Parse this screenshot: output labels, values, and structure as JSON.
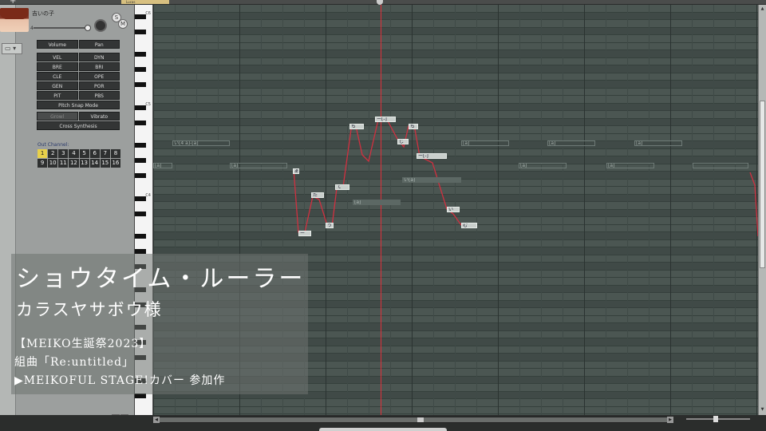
{
  "topbar": {
    "add_label": "+",
    "tab_label": "Lucas"
  },
  "track": {
    "name": "吉いの子",
    "volume_value": "4",
    "solo_label": "S",
    "mute_label": "M",
    "screen_icon": "monitor-icon"
  },
  "params": {
    "volume": "Volume",
    "pan": "Pan",
    "rows": [
      [
        "VEL",
        "DYN"
      ],
      [
        "BRE",
        "BRI"
      ],
      [
        "CLE",
        "OPE"
      ],
      [
        "GEN",
        "POR"
      ]
    ],
    "pit": "PIT",
    "pbs": "PBS",
    "pitch_snap": "Pitch Snap Mode",
    "growl": "Growl",
    "vibrato": "Vibrato",
    "cross_synthesis": "Cross Synthesis"
  },
  "out_channel": {
    "label": "Out Channel:",
    "channels": [
      "1",
      "2",
      "3",
      "4",
      "5",
      "6",
      "7",
      "8",
      "9",
      "10",
      "11",
      "12",
      "13",
      "14",
      "15",
      "16"
    ],
    "selected": "1"
  },
  "keys": {
    "c6": "C6",
    "c5": "C5",
    "c4": "C4"
  },
  "notes": [
    {
      "lyric": "[a]",
      "style": "ghost"
    },
    {
      "lyric": "[a]",
      "style": "ghost"
    },
    {
      "lyric": "い[4 a]-[a]",
      "style": "ghost"
    },
    {
      "lyric": "あ",
      "style": "solid"
    },
    {
      "lyric": "た",
      "style": "solid"
    },
    {
      "lyric": "う",
      "style": "solid"
    },
    {
      "lyric": "て",
      "style": "solid"
    },
    {
      "lyric": "ー",
      "style": "solid"
    },
    {
      "lyric": "ち",
      "style": "solid"
    },
    {
      "lyric": "[a]",
      "style": "ghostfill"
    },
    {
      "lyric": "ー[-]",
      "style": "solid"
    },
    {
      "lyric": "じ",
      "style": "solid"
    },
    {
      "lyric": "ち",
      "style": "solid"
    },
    {
      "lyric": "ー[-]",
      "style": "solid"
    },
    {
      "lyric": "い[a]",
      "style": "ghostfill"
    },
    {
      "lyric": "い",
      "style": "solid"
    },
    {
      "lyric": "む",
      "style": "solid"
    },
    {
      "lyric": "[a]",
      "style": "ghost"
    },
    {
      "lyric": "[a]",
      "style": "ghost"
    },
    {
      "lyric": "[a]",
      "style": "ghost"
    },
    {
      "lyric": "[a]",
      "style": "ghost"
    },
    {
      "lyric": "[a]",
      "style": "ghost"
    }
  ],
  "overlay": {
    "title": "ショウタイム・ルーラー",
    "artist": "カラスヤサボウ様",
    "line1": "【MEIKO生誕祭2023】",
    "line2": "組曲「Re:untitled」",
    "line3": "▶MEIKOFUL STAGE!カバー 参加作"
  },
  "colors": {
    "playhead": "#e0303a",
    "pitch_curve": "#d03040",
    "channel_selected": "#e8d04a",
    "grid_bg": "#495450"
  },
  "tool_icons": [
    "pencil-red-icon",
    "pencil-green-icon",
    "speaker-icon",
    "grid-icon",
    "grid2-icon",
    "fit-icon"
  ]
}
